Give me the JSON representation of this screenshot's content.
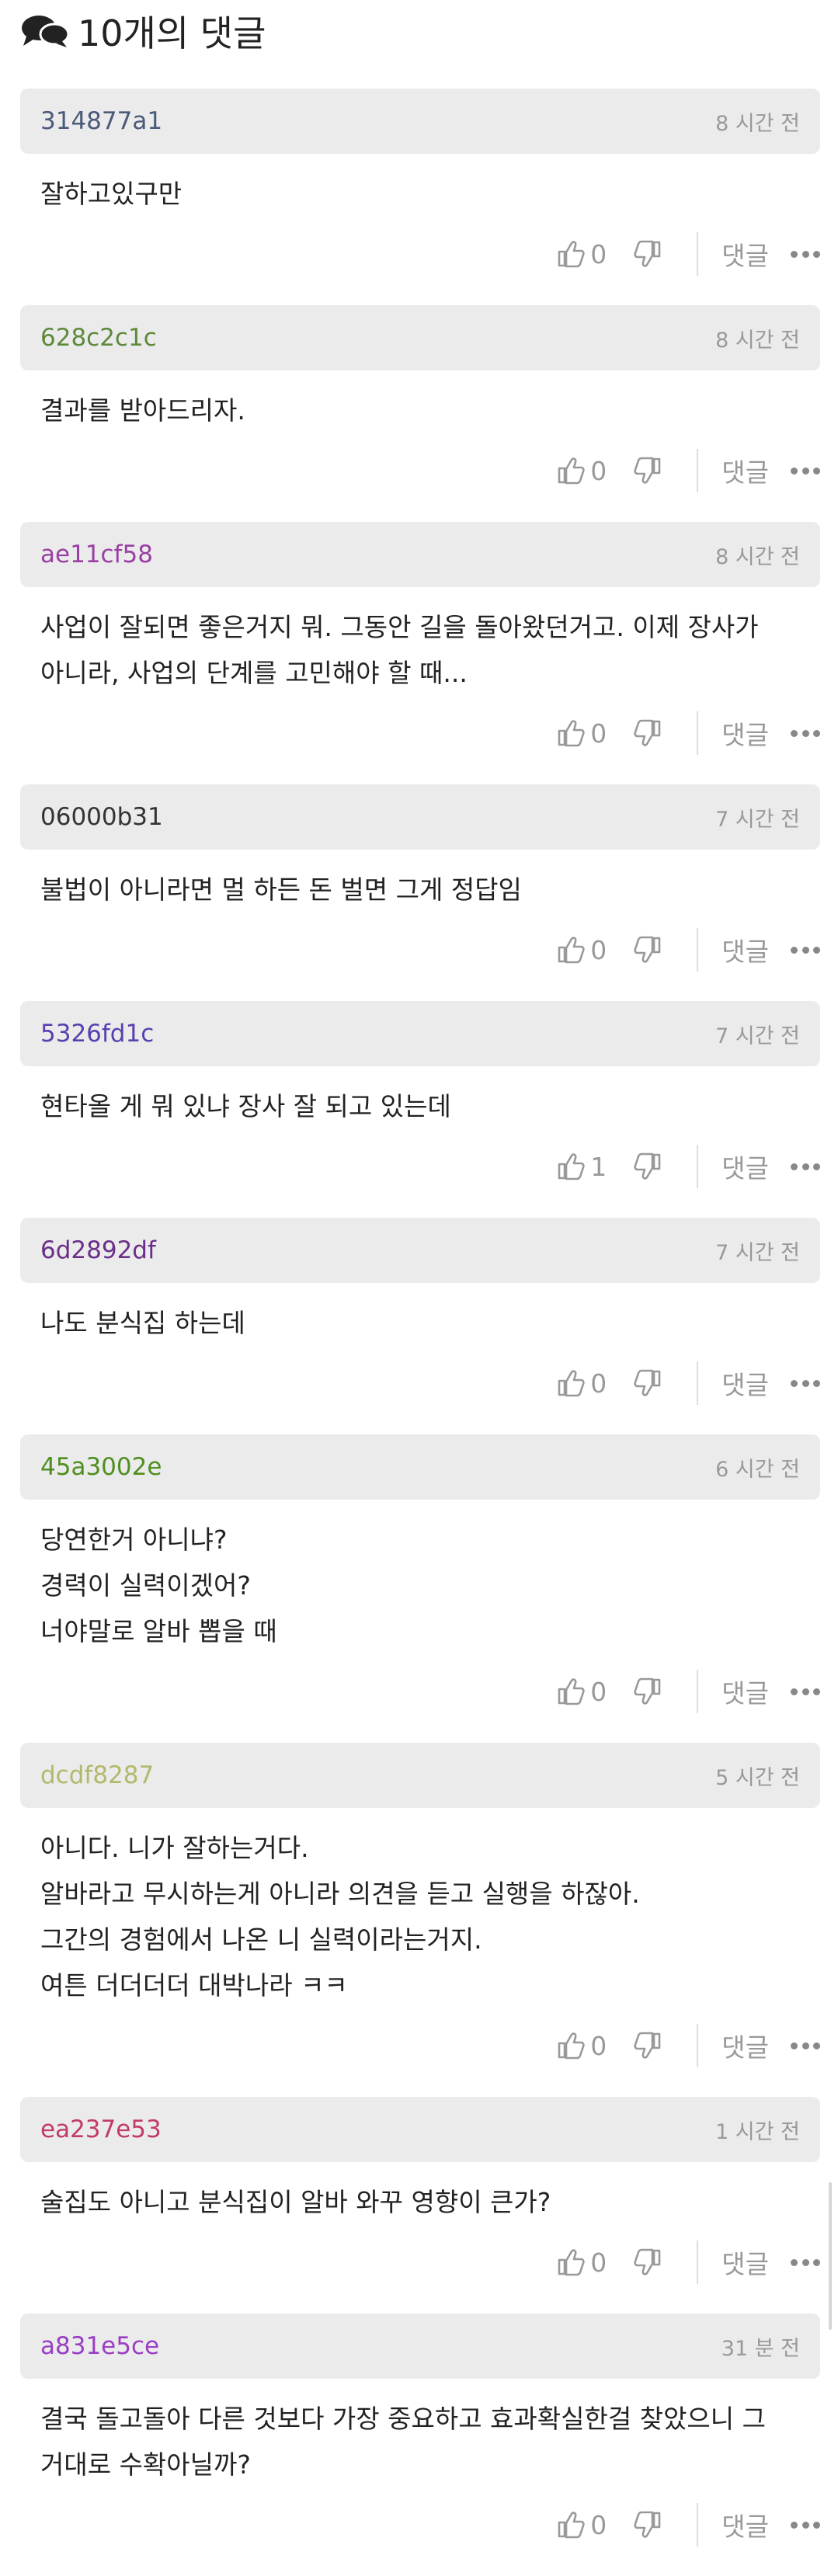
{
  "header": {
    "title": "10개의 댓글",
    "icon": "chat-bubbles-icon"
  },
  "labels": {
    "reply": "댓글"
  },
  "colors": {
    "header_bg": "#ebebeb",
    "muted": "#999999"
  },
  "comments": [
    {
      "user": "314877a1",
      "user_color": "#4a5a7a",
      "time": "8 시간 전",
      "lines": [
        "잘하고있구만"
      ],
      "likes": "0"
    },
    {
      "user": "628c2c1c",
      "user_color": "#5e8a3c",
      "time": "8 시간 전",
      "lines": [
        "결과를 받아드리자."
      ],
      "likes": "0"
    },
    {
      "user": "ae11cf58",
      "user_color": "#9a3fa4",
      "time": "8 시간 전",
      "lines": [
        "사업이 잘되면 좋은거지 뭐. 그동안 길을 돌아왔던거고. 이제 장사가",
        "아니라, 사업의 단계를 고민해야 할 때..."
      ],
      "likes": "0"
    },
    {
      "user": "06000b31",
      "user_color": "#333333",
      "time": "7 시간 전",
      "lines": [
        "불법이 아니라면 멀 하든 돈 벌면 그게 정답임"
      ],
      "likes": "0"
    },
    {
      "user": "5326fd1c",
      "user_color": "#5a3fb0",
      "time": "7 시간 전",
      "lines": [
        "현타올 게 뭐 있냐 장사 잘 되고 있는데"
      ],
      "likes": "1"
    },
    {
      "user": "6d2892df",
      "user_color": "#6a2f8a",
      "time": "7 시간 전",
      "lines": [
        "나도 분식집 하는데"
      ],
      "likes": "0"
    },
    {
      "user": "45a3002e",
      "user_color": "#4f8f1f",
      "time": "6 시간 전",
      "lines": [
        "당연한거 아니냐?",
        "경력이 실력이겠어?",
        "너야말로 알바 뽑을 때"
      ],
      "likes": "0"
    },
    {
      "user": "dcdf8287",
      "user_color": "#b3b86a",
      "time": "5 시간 전",
      "lines": [
        "아니다. 니가 잘하는거다.",
        "알바라고 무시하는게 아니라 의견을 듣고 실행을 하잖아.",
        "그간의 경험에서 나온 니 실력이라는거지.",
        "여튼 더더더더 대박나라 ㅋㅋ"
      ],
      "likes": "0"
    },
    {
      "user": "ea237e53",
      "user_color": "#c23a6a",
      "time": "1 시간 전",
      "lines": [
        "술집도 아니고 분식집이 알바 와꾸 영향이 큰가?"
      ],
      "likes": "0"
    },
    {
      "user": "a831e5ce",
      "user_color": "#9a3fc4",
      "time": "31 분 전",
      "lines": [
        "결국 돌고돌아 다른 것보다 가장 중요하고 효과확실한걸 찾았으니 그",
        "거대로 수확아닐까?"
      ],
      "likes": "0"
    }
  ]
}
